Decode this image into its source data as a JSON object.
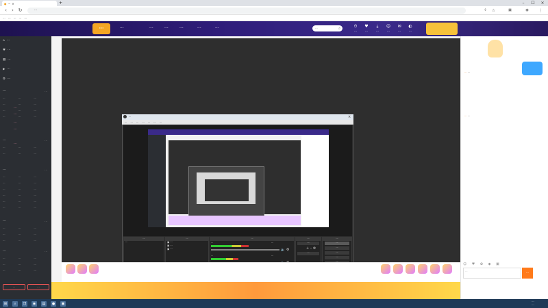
{
  "browser": {
    "tab_title": "···",
    "url": "···",
    "bookmarks": [
      "···",
      "···",
      "···",
      "···",
      "···"
    ]
  },
  "site": {
    "brand": "···",
    "nav": [
      "···",
      "···",
      "···",
      "···",
      "···",
      "···"
    ],
    "search_placeholder": "···",
    "header_icons": [
      {
        "icon": "history-icon",
        "label": "···"
      },
      {
        "icon": "follow-icon",
        "label": "···"
      },
      {
        "icon": "download-icon",
        "label": "···"
      },
      {
        "icon": "user-icon",
        "label": "···"
      },
      {
        "icon": "message-icon",
        "label": "···"
      },
      {
        "icon": "avatar-icon",
        "label": "···"
      }
    ]
  },
  "sidebar": {
    "top_items": [
      "···",
      "···",
      "···",
      "···",
      "···"
    ],
    "sections": [
      {
        "title": "···",
        "more": "···",
        "items": [
          "···",
          "···",
          "···",
          "···",
          "···",
          "···",
          "···",
          "···",
          "···",
          "···",
          "···",
          "···"
        ]
      },
      {
        "title": "···",
        "more": "···",
        "items": [
          "···",
          "···",
          "···",
          "···",
          "···",
          "···"
        ]
      },
      {
        "title": "···",
        "more": "···",
        "items": [
          "···",
          "···",
          "···",
          "···",
          "···",
          "···",
          "···",
          "···",
          "···",
          "···",
          "···",
          "···",
          "···",
          "···",
          "···",
          "···",
          "···",
          "···"
        ]
      },
      {
        "title": "···",
        "more": "···",
        "items": [
          "···",
          "···",
          "···",
          "···",
          "···",
          "···",
          "···",
          "···",
          "···"
        ]
      },
      {
        "title": "···",
        "more": "···",
        "items": [
          "···",
          "···",
          "···",
          "···",
          "···",
          "···",
          "···",
          "···",
          "···"
        ]
      }
    ],
    "button_left": "···",
    "button_right": "···"
  },
  "danmu": [
    "···",
    "···",
    "···",
    "···",
    "···"
  ],
  "obs": {
    "title": "···",
    "menu": [
      "···",
      "···",
      "···",
      "···",
      "···",
      "···",
      "···"
    ],
    "scenes_header": "···",
    "scenes": [
      "···"
    ],
    "sources_header": "···",
    "sources": [
      "···",
      "···",
      "···"
    ],
    "mixer_header": "···",
    "mixer_channels": [
      {
        "name": "···",
        "db": "···",
        "level": 0.55
      },
      {
        "name": "···",
        "db": "···",
        "level": 0.4
      }
    ],
    "transitions_header": "···",
    "transition_type": "···",
    "duration": "···",
    "controls_header": "···",
    "controls": [
      "···",
      "···",
      "···",
      "···",
      "···"
    ],
    "status": "···"
  },
  "chat": {
    "messages": [
      {
        "user": "···",
        "text": "···"
      },
      {
        "user": "···",
        "text": "···"
      }
    ],
    "input_placeholder": "···",
    "send_label": "···"
  },
  "taskbar": {
    "time": "···",
    "date": "···"
  },
  "colors": {
    "header_bg": "#2f1d7a",
    "sidebar_bg": "#2b2e33",
    "accent": "#ff7a1a",
    "danmu": "#ff9db5"
  }
}
